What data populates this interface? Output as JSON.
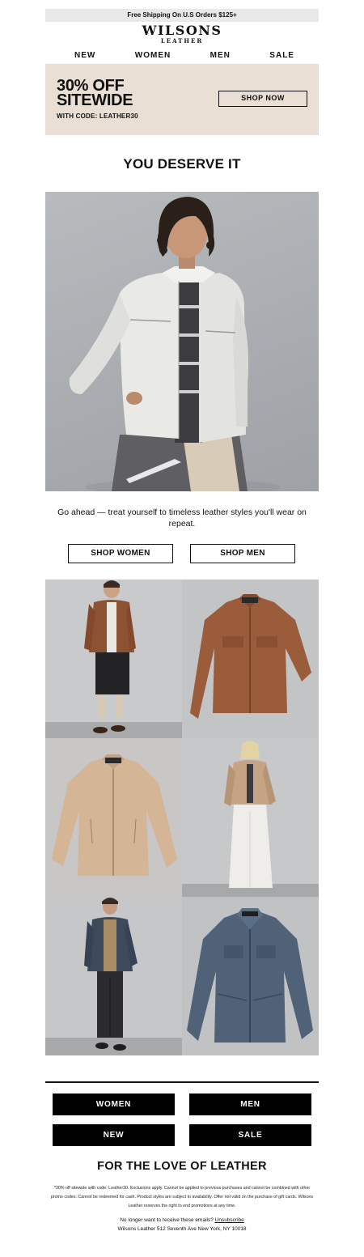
{
  "topbar": {
    "text": "Free Shipping On U.S Orders $125+"
  },
  "logo": {
    "main": "WILSONS",
    "sub": "LEATHER"
  },
  "nav": {
    "items": [
      "NEW",
      "WOMEN",
      "MEN",
      "SALE"
    ]
  },
  "hero": {
    "line1": "30% OFF",
    "line2": "SITEWIDE",
    "code": "WITH CODE: LEATHER30",
    "cta": "SHOP NOW"
  },
  "headline": "YOU DESERVE IT",
  "body": {
    "text": "Go ahead — treat yourself to timeless leather styles you'll wear on repeat."
  },
  "buttons": {
    "women": "SHOP WOMEN",
    "men": "SHOP MEN"
  },
  "footer_nav": {
    "women": "WOMEN",
    "men": "MEN",
    "new": "NEW",
    "sale": "SALE"
  },
  "footer": {
    "title": "FOR THE LOVE OF LEATHER",
    "disclaimer": "*30% off sitewide with code: Leather30. Exclusions apply. Cannot be applied to previous purchases and cannot be combined with other promo codes. Cannot be redeemed for cash. Product styles are subject to availability. Offer not valid on the purchase of gift cards. Wilsons Leather reserves the right to end promotions at any time.",
    "unsub_prefix": "No longer want to receive these emails?",
    "unsub_link": "Unsubscribe",
    "address": "Wilsons Leather 512 Seventh Ave New York, NY 10018"
  },
  "colors": {
    "hero_bg": "#e9dfd5",
    "topbar_bg": "#e9e9e9",
    "button_black": "#000000"
  }
}
